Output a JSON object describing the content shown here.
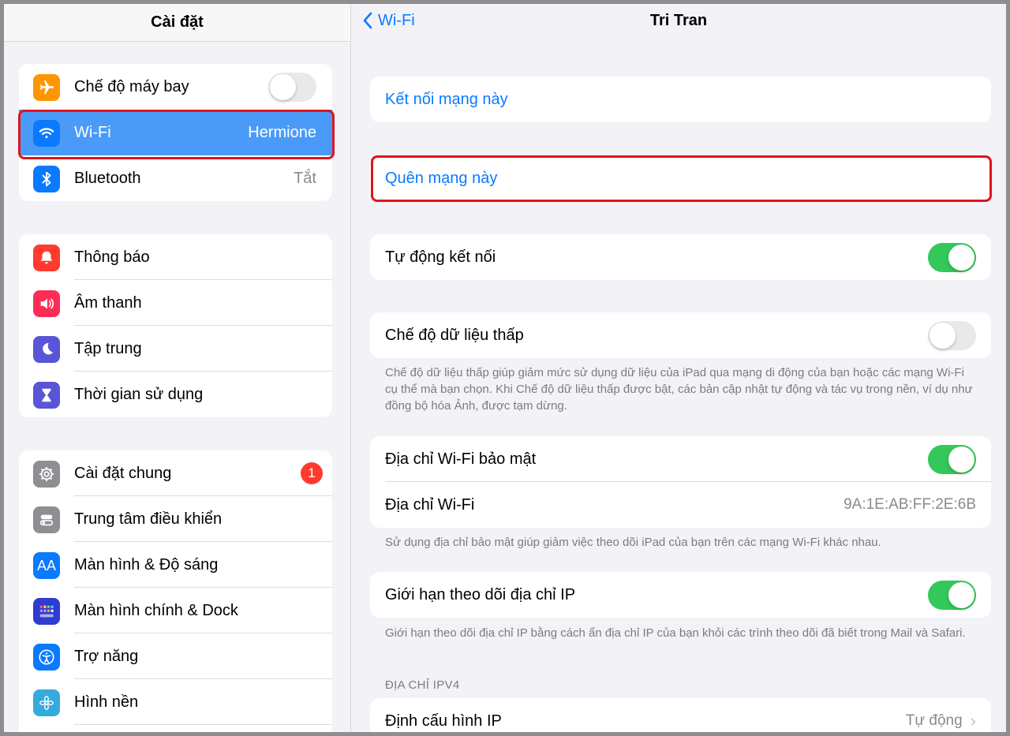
{
  "sidebar": {
    "title": "Cài đặt",
    "group1": [
      {
        "label": "Chế độ máy bay",
        "icon": "airplane-icon",
        "color": "#ff9500",
        "toggle": false
      },
      {
        "label": "Wi-Fi",
        "icon": "wifi-icon",
        "color": "#0a7aff",
        "value": "Hermione",
        "selected": true
      },
      {
        "label": "Bluetooth",
        "icon": "bluetooth-icon",
        "color": "#0a7aff",
        "value": "Tắt"
      }
    ],
    "group2": [
      {
        "label": "Thông báo",
        "icon": "bell-icon",
        "color": "#ff3b30"
      },
      {
        "label": "Âm thanh",
        "icon": "speaker-icon",
        "color": "#ff2d55"
      },
      {
        "label": "Tập trung",
        "icon": "moon-icon",
        "color": "#5856d6"
      },
      {
        "label": "Thời gian sử dụng",
        "icon": "hourglass-icon",
        "color": "#5856d6"
      }
    ],
    "group3": [
      {
        "label": "Cài đặt chung",
        "icon": "gear-icon",
        "color": "#8e8e93",
        "badge": "1"
      },
      {
        "label": "Trung tâm điều khiển",
        "icon": "switches-icon",
        "color": "#8e8e93"
      },
      {
        "label": "Màn hình & Độ sáng",
        "icon": "text-size-icon",
        "color": "#0a7aff"
      },
      {
        "label": "Màn hình chính & Dock",
        "icon": "home-grid-icon",
        "color": "#2f3bd1"
      },
      {
        "label": "Trợ năng",
        "icon": "accessibility-icon",
        "color": "#0a7aff"
      },
      {
        "label": "Hình nền",
        "icon": "flower-icon",
        "color": "#35aadc"
      }
    ]
  },
  "detail": {
    "back_label": "Wi-Fi",
    "title": "Tri Tran",
    "join_label": "Kết nối mạng này",
    "forget_label": "Quên mạng này",
    "auto_join_label": "Tự động kết nối",
    "auto_join_on": true,
    "low_data_label": "Chế độ dữ liệu thấp",
    "low_data_on": false,
    "low_data_note": "Chế độ dữ liệu thấp giúp giảm mức sử dụng dữ liệu của iPad qua mạng di động của bạn hoặc các mạng Wi-Fi cụ thể mà bạn chọn. Khi Chế độ dữ liệu thấp được bật, các bản cập nhật tự động và tác vụ trong nền, ví dụ như đồng bộ hóa Ảnh, được tạm dừng.",
    "private_addr_label": "Địa chỉ Wi-Fi bảo mật",
    "private_addr_on": true,
    "wifi_addr_label": "Địa chỉ Wi-Fi",
    "wifi_addr_value": "9A:1E:AB:FF:2E:6B",
    "private_addr_note": "Sử dụng địa chỉ bảo mật giúp giảm việc theo dõi iPad của bạn trên các mạng Wi-Fi khác nhau.",
    "limit_ip_label": "Giới hạn theo dõi địa chỉ IP",
    "limit_ip_on": true,
    "limit_ip_note": "Giới hạn theo dõi địa chỉ IP bằng cách ẩn địa chỉ IP của bạn khỏi các trình theo dõi đã biết trong Mail và Safari.",
    "ipv4_section": "ĐỊA CHỈ IPV4",
    "configure_ip_label": "Định cấu hình IP",
    "configure_ip_value": "Tự động"
  },
  "colors": {
    "accent": "#0a7aff",
    "toggle_on": "#34c759",
    "highlight": "#e0141e",
    "selected_row": "#4a9bf7"
  }
}
